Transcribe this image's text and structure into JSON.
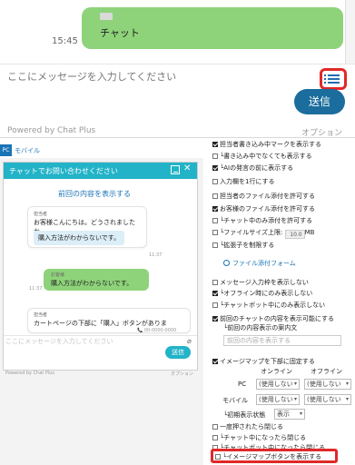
{
  "top_chat": {
    "message_text": "チャット",
    "timestamp": "15:45",
    "input_placeholder": "ここにメッセージを入力してください",
    "send_label": "送信",
    "powered_by": "Powered by Chat Plus",
    "option_label": "オプション",
    "accent_color": "#1a6d9c",
    "bubble_color": "#8ed37a",
    "highlight_color": "#e02828"
  },
  "preview": {
    "tab_pc": "PC",
    "tab_mobile": "モバイル",
    "widget_title": "チャットでお問い合わせください",
    "prev_content_link": "前回の内容を表示する",
    "messages": [
      {
        "sender": "担当者",
        "text": "お客様こんにちは。どうされましたか。",
        "chip": "購入方法がわからないです。",
        "time": "11:37"
      },
      {
        "sender": "お客様",
        "text": "購入方法がわからないです。",
        "time": "11:37"
      },
      {
        "sender": "担当者",
        "text": "カートページの下部に「購入」ボタンがありま",
        "phone": "00-0000-0000",
        "time": "11:37"
      }
    ],
    "input_placeholder": "ここにメッセージを入力してください",
    "send_label": "送信",
    "powered_by": "Powered by Chat Plus",
    "option_label": "オプション",
    "header_color": "#22b3c8"
  },
  "settings": {
    "items": [
      {
        "label": "担当者書き込み中マークを表示する",
        "checked": true
      },
      {
        "label": "└書き込み中でなくても表示する",
        "checked": false
      },
      {
        "label": "└AIの発言の前に表示する",
        "checked": true
      },
      {
        "label": "入力欄を1行にする",
        "checked": false
      },
      {
        "label": "担当者のファイル添付を許可する",
        "checked": false
      },
      {
        "label": "お客様のファイル添付を許可する",
        "checked": true
      },
      {
        "label": "└チャット中のみ添付を許可する",
        "checked": false
      },
      {
        "label": "└ファイルサイズ上限:",
        "checked": false,
        "value": "10.0",
        "unit": "MB"
      },
      {
        "label": "└拡張子を制限する",
        "checked": false
      }
    ],
    "file_form_label": "ファイル添付フォーム",
    "items2": [
      {
        "label": "メッセージ入力枠を表示しない",
        "checked": false
      },
      {
        "label": "└オフライン時にのみ表示しない",
        "checked": true
      },
      {
        "label": "└チャットボット中にのみ表示しない",
        "checked": false
      },
      {
        "label": "前回のチャットの内容を表示可能にする",
        "checked": true
      },
      {
        "label": "└前回の内容表示の案内文",
        "checked": null
      }
    ],
    "prev_content_input": "前回の内容を表示する",
    "image_map_bottom": {
      "label": "イメージマップを下部に固定する",
      "checked": true
    },
    "col_online": "オンライン",
    "col_offline": "オフライン",
    "row_pc": "PC",
    "row_mobile": "モバイル",
    "select_unused": "(使用しない",
    "initial_state_label": "└初期表示状態",
    "initial_state_value": "表示",
    "items3": [
      {
        "label": "一度押されたら閉じる",
        "checked": false
      },
      {
        "label": "└チャット中になったら閉じる",
        "checked": false
      },
      {
        "label": "└チャットボット中になったら閉じる",
        "checked": false
      },
      {
        "label": "└イメージマップボタンを表示する",
        "checked": false
      }
    ]
  }
}
